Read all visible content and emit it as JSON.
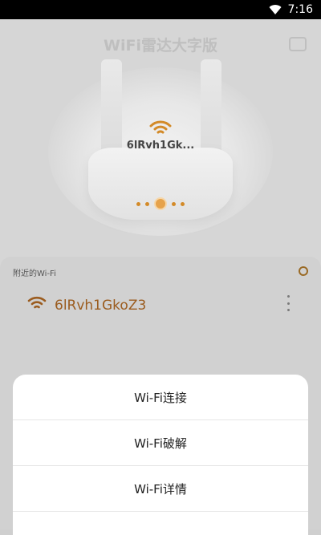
{
  "status_bar": {
    "time": "7:16"
  },
  "app": {
    "title": "WiFi雷达大字版"
  },
  "hero": {
    "ssid": "6lRvh1Gk..."
  },
  "nearby": {
    "title": "附近的Wi-Fi",
    "networks": [
      {
        "name": "6lRvh1GkoZ3"
      }
    ]
  },
  "sheet": {
    "items": [
      {
        "label": "Wi-Fi连接"
      },
      {
        "label": "Wi-Fi破解"
      },
      {
        "label": "Wi-Fi详情"
      },
      {
        "label": ""
      }
    ]
  },
  "colors": {
    "accent": "#d38a28",
    "network_text": "#9b5c1f"
  }
}
